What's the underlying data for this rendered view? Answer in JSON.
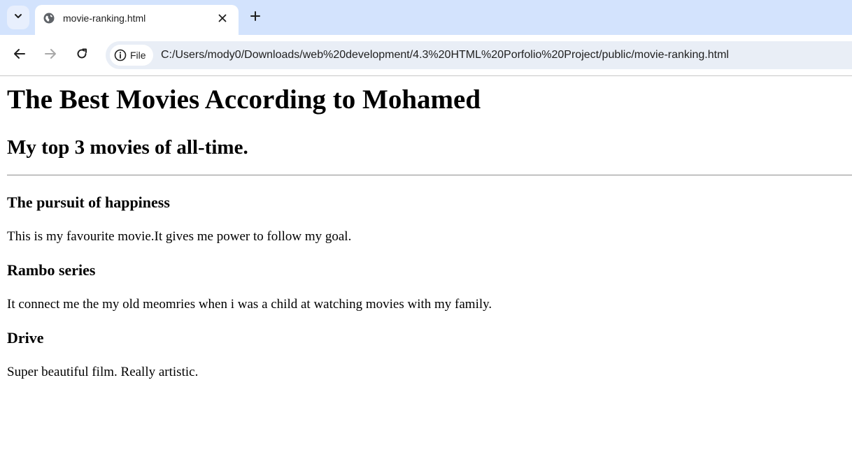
{
  "browser": {
    "tab": {
      "title": "movie-ranking.html",
      "favicon": "globe-icon"
    },
    "tab_list_icon": "chevron-down-icon",
    "close_icon": "close-icon",
    "new_tab_icon": "plus-icon",
    "nav": {
      "back_icon": "arrow-left-icon",
      "forward_icon": "arrow-right-icon",
      "reload_icon": "reload-icon"
    },
    "omnibox": {
      "chip_icon": "info-icon",
      "chip_label": "File",
      "url": "C:/Users/mody0/Downloads/web%20development/4.3%20HTML%20Porfolio%20Project/public/movie-ranking.html"
    },
    "colors": {
      "tabstrip_bg": "#d3e3fd",
      "omnibox_bg": "#e9eef6",
      "forward_disabled": "#a8a8a8"
    }
  },
  "page": {
    "heading": "The Best Movies According to Mohamed",
    "subheading": "My top 3 movies of all-time.",
    "movies": [
      {
        "title": "The pursuit of happiness",
        "description": "This is my favourite movie.It gives me power to follow my goal."
      },
      {
        "title": "Rambo series",
        "description": "It connect me the my old meomries when i was a child at watching movies with my family."
      },
      {
        "title": "Drive",
        "description": "Super beautiful film. Really artistic."
      }
    ]
  }
}
